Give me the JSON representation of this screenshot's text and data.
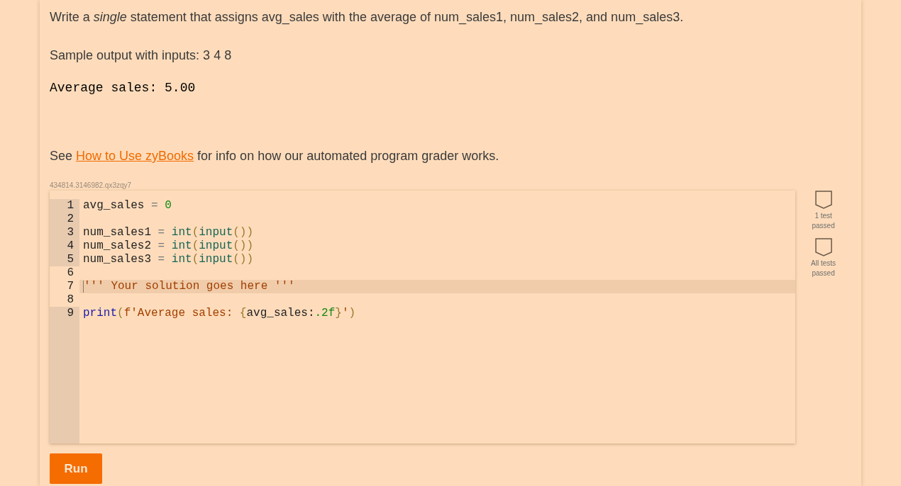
{
  "prompt": "Write a *single* statement that assigns avg_sales with the average of num_sales1, num_sales2, and num_sales3.",
  "sample_label": "Sample output with inputs: 3 4 8",
  "sample_output": "Average sales: 5.00",
  "info": {
    "before": "See ",
    "link": "How to Use zyBooks",
    "after": " for info on how our automated program grader works."
  },
  "challenge_id": "434814.3146982.qx3zqy7",
  "code_lines": [
    {
      "number": "1",
      "readonly": true,
      "active": false,
      "tokens": [
        {
          "kind": "plain",
          "text": "avg_sales"
        },
        {
          "kind": "op",
          "text": " = "
        },
        {
          "kind": "number",
          "text": "0"
        }
      ]
    },
    {
      "number": "2",
      "readonly": true,
      "active": false
    },
    {
      "number": "3",
      "readonly": true,
      "active": false,
      "tokens": [
        {
          "kind": "plain",
          "text": "num_sales1"
        },
        {
          "kind": "op",
          "text": " = "
        },
        {
          "kind": "builtin",
          "text": "int"
        },
        {
          "kind": "paren",
          "text": "("
        },
        {
          "kind": "builtin",
          "text": "input"
        },
        {
          "kind": "paren",
          "text": "())"
        }
      ]
    },
    {
      "number": "4",
      "readonly": true,
      "active": false,
      "tokens": [
        {
          "kind": "plain",
          "text": "num_sales2"
        },
        {
          "kind": "op",
          "text": " = "
        },
        {
          "kind": "builtin",
          "text": "int"
        },
        {
          "kind": "paren",
          "text": "("
        },
        {
          "kind": "builtin",
          "text": "input"
        },
        {
          "kind": "paren",
          "text": "())"
        }
      ]
    },
    {
      "number": "5",
      "readonly": true,
      "active": false,
      "tokens": [
        {
          "kind": "plain",
          "text": "num_sales3"
        },
        {
          "kind": "op",
          "text": " = "
        },
        {
          "kind": "builtin",
          "text": "int"
        },
        {
          "kind": "paren",
          "text": "("
        },
        {
          "kind": "builtin",
          "text": "input"
        },
        {
          "kind": "paren",
          "text": "())"
        }
      ]
    },
    {
      "number": "6",
      "readonly": false,
      "active": false
    },
    {
      "number": "7",
      "readonly": false,
      "active": true,
      "tokens": [
        {
          "kind": "string",
          "text": "''' Your solution goes here '''"
        }
      ]
    },
    {
      "number": "8",
      "readonly": false,
      "active": false
    },
    {
      "number": "9",
      "readonly": true,
      "active": false,
      "tokens": [
        {
          "kind": "keyword",
          "text": "print"
        },
        {
          "kind": "paren",
          "text": "("
        },
        {
          "kind": "string",
          "text": "f'Average sales: "
        },
        {
          "kind": "paren",
          "text": "{"
        },
        {
          "kind": "plain",
          "text": "avg_sales:"
        },
        {
          "kind": "number",
          "text": ".2f"
        },
        {
          "kind": "paren",
          "text": "}"
        },
        {
          "kind": "string",
          "text": "'"
        },
        {
          "kind": "paren",
          "text": ")"
        }
      ]
    }
  ],
  "tests": [
    {
      "label": "1 test passed",
      "passed": false
    },
    {
      "label": "All tests passed",
      "passed": false
    }
  ],
  "run_button": "Run"
}
